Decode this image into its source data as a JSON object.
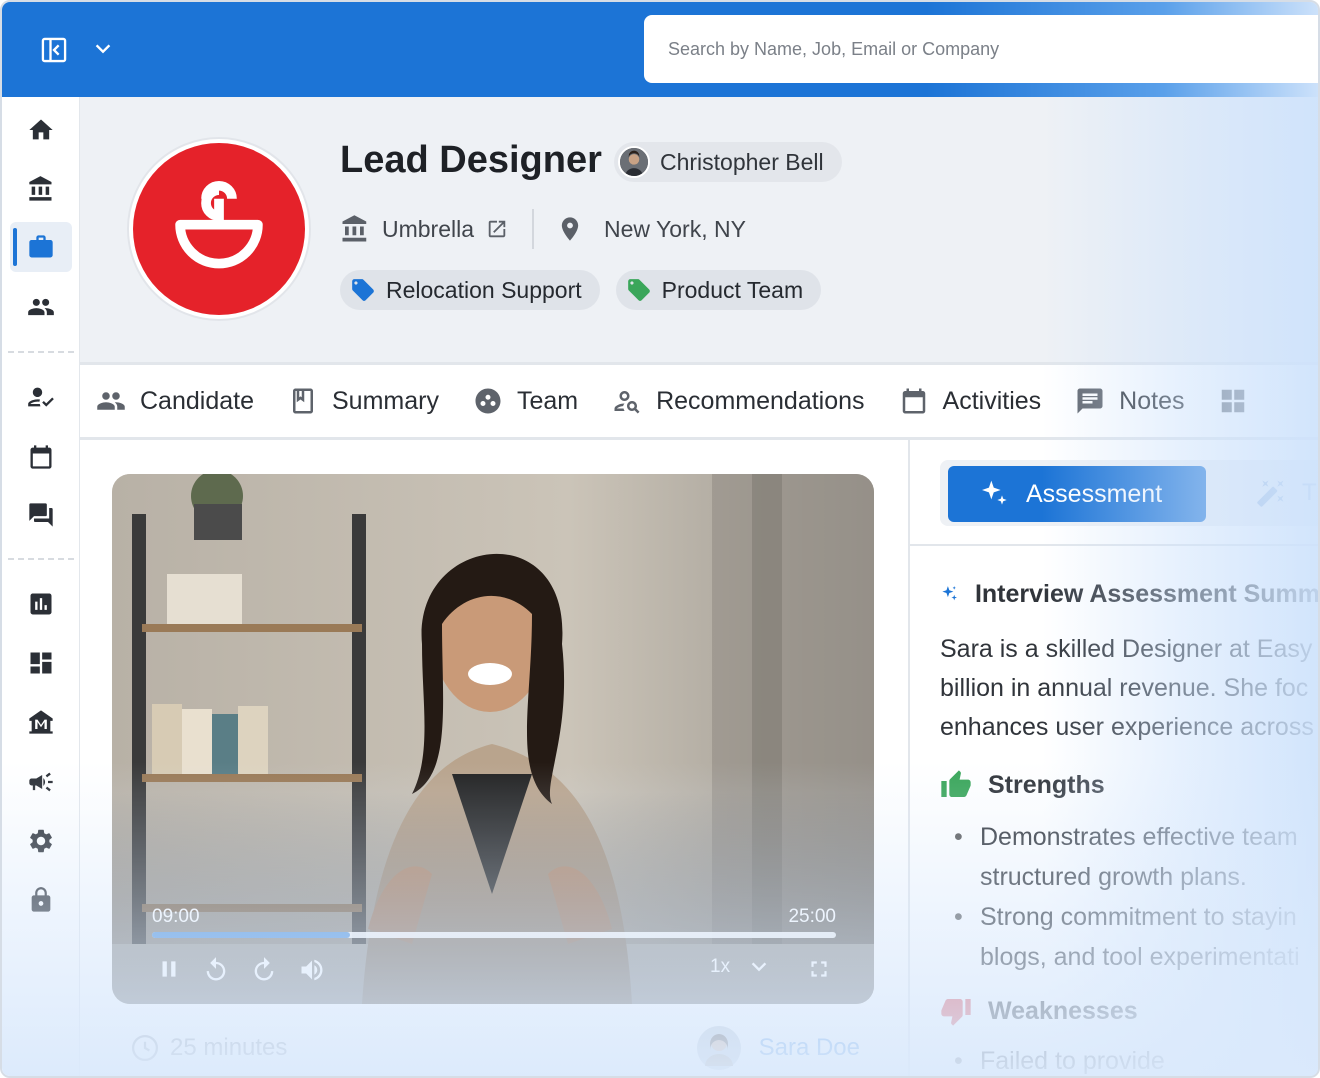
{
  "search": {
    "placeholder": "Search by Name, Job, Email or Company"
  },
  "job": {
    "title": "Lead Designer",
    "owner": "Christopher Bell",
    "company": "Umbrella",
    "location": "New York, NY",
    "tags": [
      "Relocation Support",
      "Product Team"
    ],
    "tag_colors": [
      "#1c74d6",
      "#3aa65a"
    ]
  },
  "tabs": [
    "Candidate",
    "Summary",
    "Team",
    "Recommendations",
    "Activities",
    "Notes"
  ],
  "video": {
    "current_time": "09:00",
    "duration": "25:00",
    "progress": 0.29,
    "speed": "1x"
  },
  "interview": {
    "length": "25 minutes",
    "candidate": "Sara Doe"
  },
  "assessment": {
    "tab_label": "Assessment",
    "tab2_label": "T",
    "summary_title": "Interview Assessment Summ",
    "summary_lines": [
      "Sara is a skilled Designer at Easy",
      "billion in annual revenue. She foc",
      "enhances user experience across"
    ],
    "strengths_title": "Strengths",
    "strengths": [
      [
        "Demonstrates effective team",
        "structured growth plans."
      ],
      [
        "Strong commitment to stayin",
        "blogs, and tool experimentati"
      ]
    ],
    "weaknesses_title": "Weaknesses",
    "weakness_line": "Failed to provide"
  },
  "colors": {
    "accent": "#1c74d6",
    "brand_logo": "#e5222a"
  },
  "icons": {
    "nav": [
      "home-icon",
      "bank-icon",
      "briefcase-icon",
      "people-icon",
      "user-check-icon",
      "calendar-icon",
      "chat-icon",
      "bar-chart-icon",
      "dashboard-icon",
      "museum-icon",
      "megaphone-icon",
      "gear-icon",
      "lock-icon"
    ]
  }
}
